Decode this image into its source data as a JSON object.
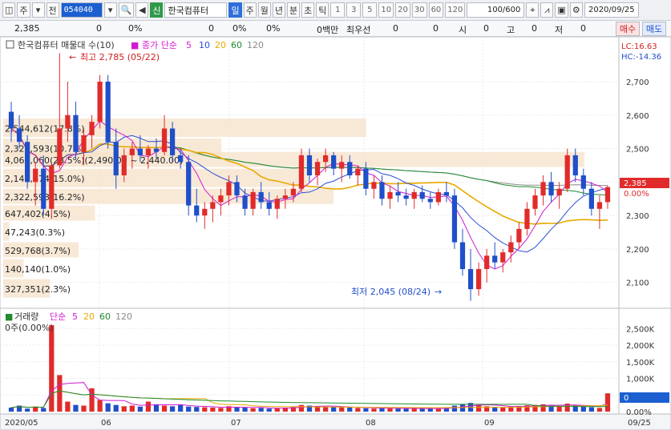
{
  "toolbar": {
    "menu_icon": "window-icon",
    "market": "주",
    "prev": "전",
    "stock_code": "054040",
    "search_icon": "search-icon",
    "sound_icon": "speaker-icon",
    "new_badge": "신",
    "stock_name": "한국컴퓨터",
    "periods": [
      "일",
      "주",
      "월",
      "년",
      "분",
      "초",
      "틱"
    ],
    "active_period": "일",
    "intervals": [
      "1",
      "3",
      "5",
      "10",
      "20",
      "30",
      "60",
      "120"
    ],
    "count": "100/600",
    "date": "2020/09/25",
    "tool_icons": [
      "crosshair-icon",
      "indicator-icon",
      "save-icon",
      "settings-icon"
    ]
  },
  "info": {
    "price": "2,385",
    "change": "0",
    "change_pct": "0%",
    "volume": "0",
    "volume_pct": "0%",
    "amount": "0백만",
    "bid_label": "최우선",
    "bid1": "0",
    "bid2": "0",
    "open_label": "시",
    "open": "0",
    "high_label": "고",
    "high": "0",
    "low_label": "저",
    "low": "0",
    "buy": "매수",
    "sell": "매도"
  },
  "price_legend": {
    "title": "한국컴퓨터 매물대 수(10)",
    "close_label": "종가 단순",
    "ma": [
      "5",
      "10",
      "20",
      "60",
      "120"
    ],
    "lc": "LC:16.63",
    "hc": "HC:-14.36"
  },
  "volume_legend": {
    "title": "거래량",
    "ma_label": "단순",
    "ma": [
      "5",
      "20",
      "60",
      "120"
    ],
    "current": "0주(0.00%)"
  },
  "annotations": {
    "high": "최고 2,785 (05/22)",
    "low": "최저 2,045 (08/24)",
    "current_price": "2,385",
    "current_pct": "0.00%",
    "vol_current": "0",
    "vol_pct": "0.00%"
  },
  "volume_profile": [
    {
      "label": "2,544,612(17.8%)",
      "price_lo": 2530,
      "price_hi": 2590,
      "pct": 17.8
    },
    {
      "label": "4,064,060(28.5%)(2,490.00 ~ 2,440.00)",
      "price_lo": 2440,
      "price_hi": 2490,
      "pct": 28.5
    },
    {
      "label": "2,140,874(15.0%)",
      "price_lo": 2380,
      "price_hi": 2440,
      "pct": 15.0
    },
    {
      "label": "2,322,593(16.2%)",
      "price_lo": 2330,
      "price_hi": 2380,
      "pct": 16.2
    },
    {
      "label": "2,322,593(10.7%)",
      "price_lo": 2470,
      "price_hi": 2530,
      "pct": 10.7
    },
    {
      "label": "647,402(4.5%)",
      "price_lo": 2280,
      "price_hi": 2330,
      "pct": 4.5
    },
    {
      "label": "47,243(0.3%)",
      "price_lo": 2220,
      "price_hi": 2280,
      "pct": 0.3
    },
    {
      "label": "529,768(3.7%)",
      "price_lo": 2170,
      "price_hi": 2220,
      "pct": 3.7
    },
    {
      "label": "140,140(1.0%)",
      "price_lo": 2110,
      "price_hi": 2170,
      "pct": 1.0
    },
    {
      "label": "327,351(2.3%)",
      "price_lo": 2050,
      "price_hi": 2110,
      "pct": 2.3
    }
  ],
  "chart_data": {
    "type": "candlestick",
    "title": "한국컴퓨터",
    "x_ticks": [
      "2020/05",
      "06",
      "07",
      "08",
      "09",
      "09/25"
    ],
    "price_axis": [
      "2,700",
      "2,600",
      "2,500",
      "2,400",
      "2,300",
      "2,200",
      "2,100"
    ],
    "price_ylim": [
      2030,
      2810
    ],
    "volume_axis": [
      "2,500K",
      "2,000K",
      "1,500K",
      "1,000K",
      "500K",
      "0.00%"
    ],
    "volume_ylim": [
      0,
      2700
    ],
    "candles": [
      [
        2610,
        2640,
        2520,
        2560
      ],
      [
        2560,
        2600,
        2500,
        2520
      ],
      [
        2520,
        2540,
        2380,
        2400
      ],
      [
        2400,
        2460,
        2330,
        2440
      ],
      [
        2440,
        2480,
        2300,
        2320
      ],
      [
        2320,
        2460,
        2290,
        2450
      ],
      [
        2450,
        2785,
        2440,
        2560
      ],
      [
        2560,
        2700,
        2520,
        2600
      ],
      [
        2600,
        2640,
        2470,
        2490
      ],
      [
        2490,
        2560,
        2450,
        2540
      ],
      [
        2540,
        2600,
        2500,
        2580
      ],
      [
        2580,
        2720,
        2560,
        2700
      ],
      [
        2700,
        2720,
        2500,
        2520
      ],
      [
        2520,
        2560,
        2380,
        2420
      ],
      [
        2420,
        2500,
        2400,
        2480
      ],
      [
        2480,
        2520,
        2440,
        2500
      ],
      [
        2500,
        2540,
        2460,
        2480
      ],
      [
        2480,
        2510,
        2440,
        2500
      ],
      [
        2500,
        2530,
        2470,
        2490
      ],
      [
        2490,
        2600,
        2480,
        2560
      ],
      [
        2560,
        2580,
        2460,
        2480
      ],
      [
        2480,
        2500,
        2440,
        2460
      ],
      [
        2460,
        2480,
        2300,
        2330
      ],
      [
        2330,
        2380,
        2280,
        2300
      ],
      [
        2300,
        2340,
        2260,
        2320
      ],
      [
        2320,
        2360,
        2280,
        2340
      ],
      [
        2340,
        2380,
        2300,
        2360
      ],
      [
        2360,
        2420,
        2330,
        2400
      ],
      [
        2400,
        2420,
        2340,
        2360
      ],
      [
        2360,
        2380,
        2300,
        2320
      ],
      [
        2320,
        2380,
        2300,
        2370
      ],
      [
        2370,
        2400,
        2320,
        2340
      ],
      [
        2340,
        2370,
        2300,
        2320
      ],
      [
        2320,
        2360,
        2290,
        2350
      ],
      [
        2350,
        2380,
        2320,
        2360
      ],
      [
        2360,
        2400,
        2340,
        2380
      ],
      [
        2380,
        2500,
        2370,
        2480
      ],
      [
        2480,
        2500,
        2400,
        2420
      ],
      [
        2420,
        2470,
        2390,
        2460
      ],
      [
        2460,
        2500,
        2430,
        2480
      ],
      [
        2480,
        2490,
        2420,
        2440
      ],
      [
        2440,
        2480,
        2400,
        2460
      ],
      [
        2460,
        2480,
        2410,
        2420
      ],
      [
        2420,
        2450,
        2390,
        2440
      ],
      [
        2440,
        2460,
        2360,
        2380
      ],
      [
        2380,
        2420,
        2350,
        2400
      ],
      [
        2400,
        2420,
        2330,
        2350
      ],
      [
        2350,
        2390,
        2320,
        2370
      ],
      [
        2370,
        2400,
        2340,
        2360
      ],
      [
        2360,
        2380,
        2330,
        2350
      ],
      [
        2350,
        2380,
        2320,
        2370
      ],
      [
        2370,
        2390,
        2340,
        2350
      ],
      [
        2350,
        2370,
        2320,
        2340
      ],
      [
        2340,
        2380,
        2330,
        2370
      ],
      [
        2370,
        2400,
        2340,
        2360
      ],
      [
        2360,
        2380,
        2200,
        2220
      ],
      [
        2220,
        2260,
        2120,
        2140
      ],
      [
        2140,
        2200,
        2045,
        2080
      ],
      [
        2080,
        2160,
        2060,
        2140
      ],
      [
        2140,
        2200,
        2100,
        2180
      ],
      [
        2180,
        2220,
        2140,
        2160
      ],
      [
        2160,
        2200,
        2130,
        2190
      ],
      [
        2190,
        2240,
        2160,
        2220
      ],
      [
        2220,
        2280,
        2200,
        2260
      ],
      [
        2260,
        2340,
        2240,
        2320
      ],
      [
        2320,
        2380,
        2300,
        2360
      ],
      [
        2360,
        2420,
        2330,
        2400
      ],
      [
        2400,
        2430,
        2340,
        2360
      ],
      [
        2360,
        2400,
        2320,
        2380
      ],
      [
        2380,
        2500,
        2370,
        2480
      ],
      [
        2480,
        2500,
        2400,
        2420
      ],
      [
        2420,
        2440,
        2360,
        2380
      ],
      [
        2380,
        2400,
        2300,
        2320
      ],
      [
        2320,
        2360,
        2260,
        2340
      ],
      [
        2340,
        2390,
        2320,
        2385
      ]
    ],
    "volume": [
      120,
      180,
      90,
      150,
      110,
      2600,
      1100,
      300,
      200,
      180,
      700,
      350,
      250,
      200,
      160,
      180,
      150,
      300,
      220,
      180,
      160,
      200,
      150,
      140,
      130,
      120,
      110,
      160,
      140,
      120,
      100,
      110,
      90,
      100,
      120,
      140,
      200,
      180,
      160,
      150,
      140,
      130,
      120,
      110,
      100,
      90,
      110,
      100,
      95,
      90,
      85,
      100,
      95,
      90,
      110,
      180,
      220,
      260,
      200,
      160,
      140,
      130,
      150,
      170,
      190,
      200,
      220,
      180,
      160,
      240,
      200,
      150,
      130,
      110,
      550
    ],
    "ma_colors": {
      "ma5": "#d11bd1",
      "ma10": "#2a4fd8",
      "ma20": "#e8a900",
      "ma60": "#1f8a2e",
      "ma120": "#8a8a8a"
    }
  }
}
